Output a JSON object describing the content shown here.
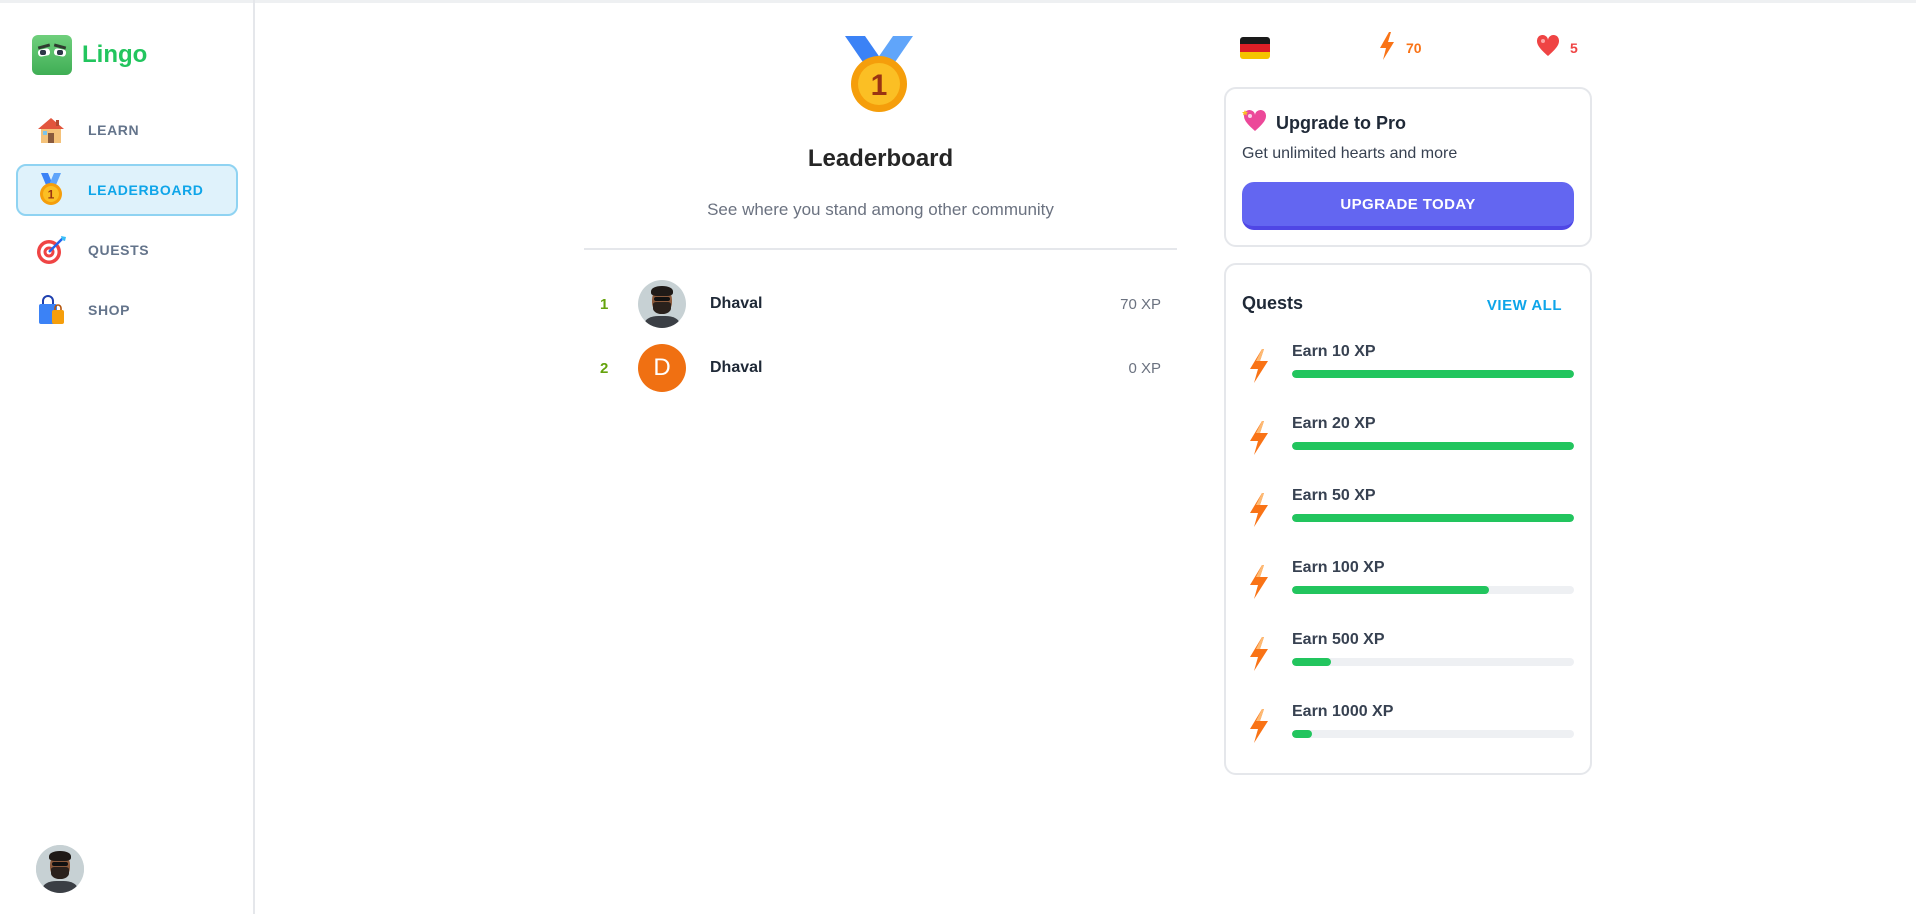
{
  "app": {
    "name": "Lingo"
  },
  "sidebar": {
    "items": [
      {
        "key": "learn",
        "label": "LEARN",
        "icon": "house-icon",
        "active": false
      },
      {
        "key": "leaderboard",
        "label": "LEADERBOARD",
        "icon": "medal-icon",
        "active": true
      },
      {
        "key": "quests",
        "label": "QUESTS",
        "icon": "target-icon",
        "active": false
      },
      {
        "key": "shop",
        "label": "SHOP",
        "icon": "shopping-bag-icon",
        "active": false
      }
    ]
  },
  "main": {
    "medal_rank": "1",
    "title": "Leaderboard",
    "subtitle": "See where you stand among other community",
    "rows": [
      {
        "rank": "1",
        "name": "Dhaval",
        "xp": "70 XP",
        "avatar": "photo"
      },
      {
        "rank": "2",
        "name": "Dhaval",
        "xp": "0 XP",
        "avatar": "letter",
        "initial": "D"
      }
    ]
  },
  "stats": {
    "flag": "germany-flag-icon",
    "points": "70",
    "hearts": "5"
  },
  "pro": {
    "title": "Upgrade to Pro",
    "subtitle": "Get unlimited hearts and more",
    "button": "UPGRADE TODAY"
  },
  "quests": {
    "title": "Quests",
    "view_all": "VIEW ALL",
    "items": [
      {
        "label": "Earn 10 XP",
        "progress": 1.0
      },
      {
        "label": "Earn 20 XP",
        "progress": 1.0
      },
      {
        "label": "Earn 50 XP",
        "progress": 1.0
      },
      {
        "label": "Earn 100 XP",
        "progress": 0.7
      },
      {
        "label": "Earn 500 XP",
        "progress": 0.14
      },
      {
        "label": "Earn 1000 XP",
        "progress": 0.07
      }
    ]
  },
  "colors": {
    "brand_green": "#22c55e",
    "active_blue": "#0ea5e9",
    "upgrade_purple": "#6366f1",
    "rank_green": "#65a30d",
    "avatar_orange": "#f07012"
  }
}
